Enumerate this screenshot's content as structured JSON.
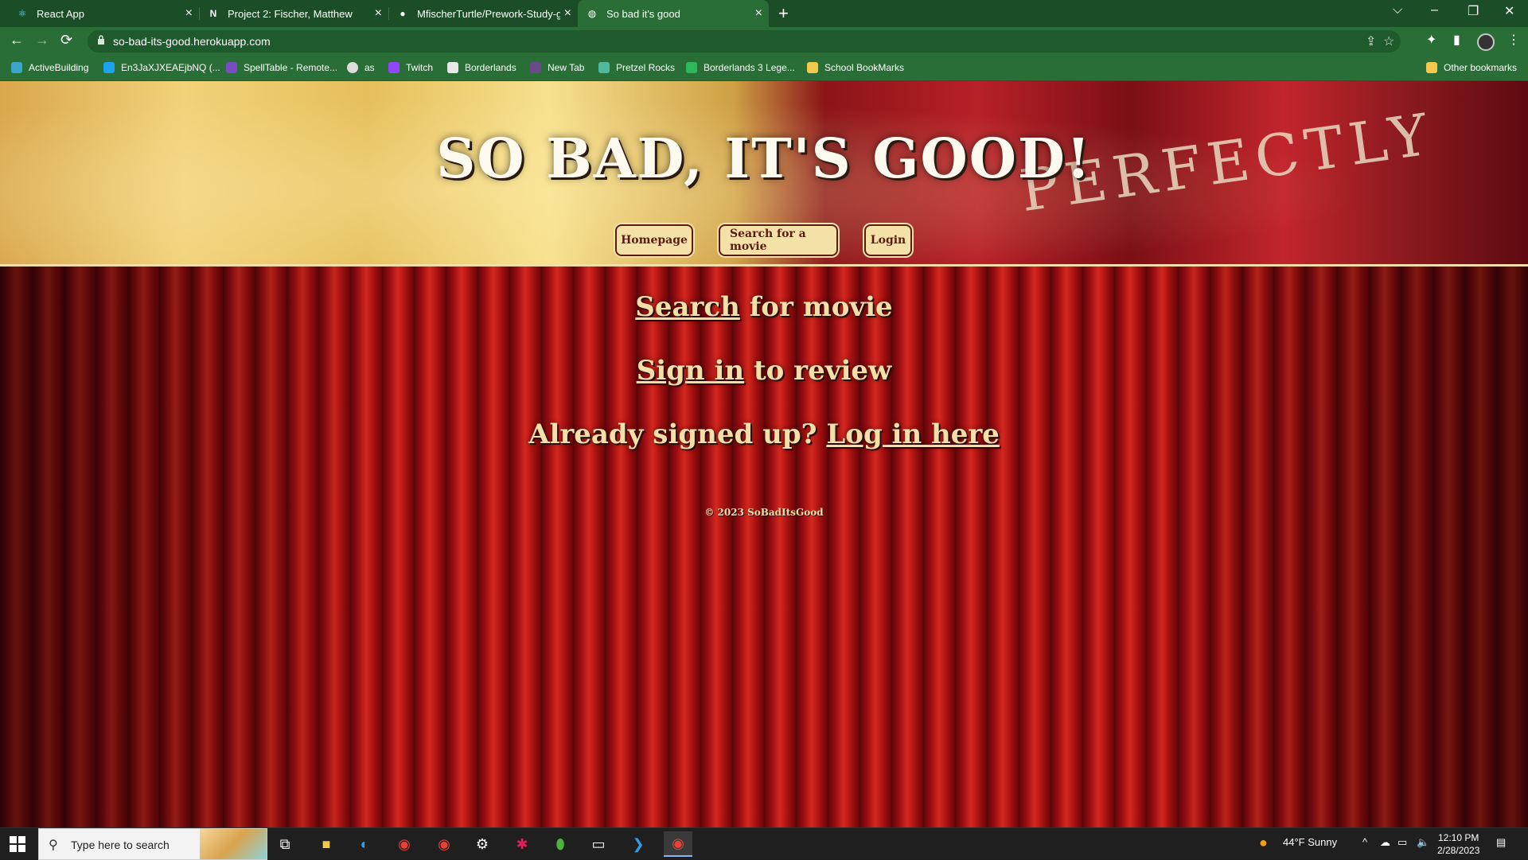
{
  "browser": {
    "tabs": [
      {
        "title": "React App",
        "icon": "react-icon"
      },
      {
        "title": "Project 2: Fischer, Matthew",
        "icon": "notion-icon"
      },
      {
        "title": "MfischerTurtle/Prework-Study-gu",
        "icon": "github-icon"
      },
      {
        "title": "So bad it's good",
        "icon": "globe-icon"
      }
    ],
    "url": "so-bad-its-good.herokuapp.com",
    "bookmarks": [
      {
        "label": "ActiveBuilding"
      },
      {
        "label": "En3JaXJXEAEjbNQ (..."
      },
      {
        "label": "SpellTable - Remote..."
      },
      {
        "label": "as"
      },
      {
        "label": "Twitch"
      },
      {
        "label": "Borderlands"
      },
      {
        "label": "New Tab"
      },
      {
        "label": "Pretzel Rocks"
      },
      {
        "label": "Borderlands 3 Lege..."
      },
      {
        "label": "School BookMarks"
      }
    ],
    "other_bookmarks": "Other bookmarks"
  },
  "site": {
    "title": "SO BAD, IT'S GOOD!",
    "hero_print": "PERFECTLY",
    "nav": [
      {
        "label": "Homepage"
      },
      {
        "label": "Search for a movie"
      },
      {
        "label": "Login"
      }
    ],
    "line1": {
      "link": "Search",
      "text": " for movie"
    },
    "line2": {
      "link": "Sign in",
      "text": " to review"
    },
    "line3": {
      "text": "Already signed up? ",
      "link": "Log in here"
    },
    "footer": "© 2023 SoBadItsGood"
  },
  "taskbar": {
    "search_placeholder": "Type here to search",
    "weather": "44°F  Sunny",
    "time": "12:10 PM",
    "date": "2/28/2023"
  },
  "colors": {
    "chrome_green": "#2a6e37",
    "nav_bg": "#f4e1a8",
    "nav_text": "#5d1a12",
    "text_cream": "#f3e0a8"
  }
}
